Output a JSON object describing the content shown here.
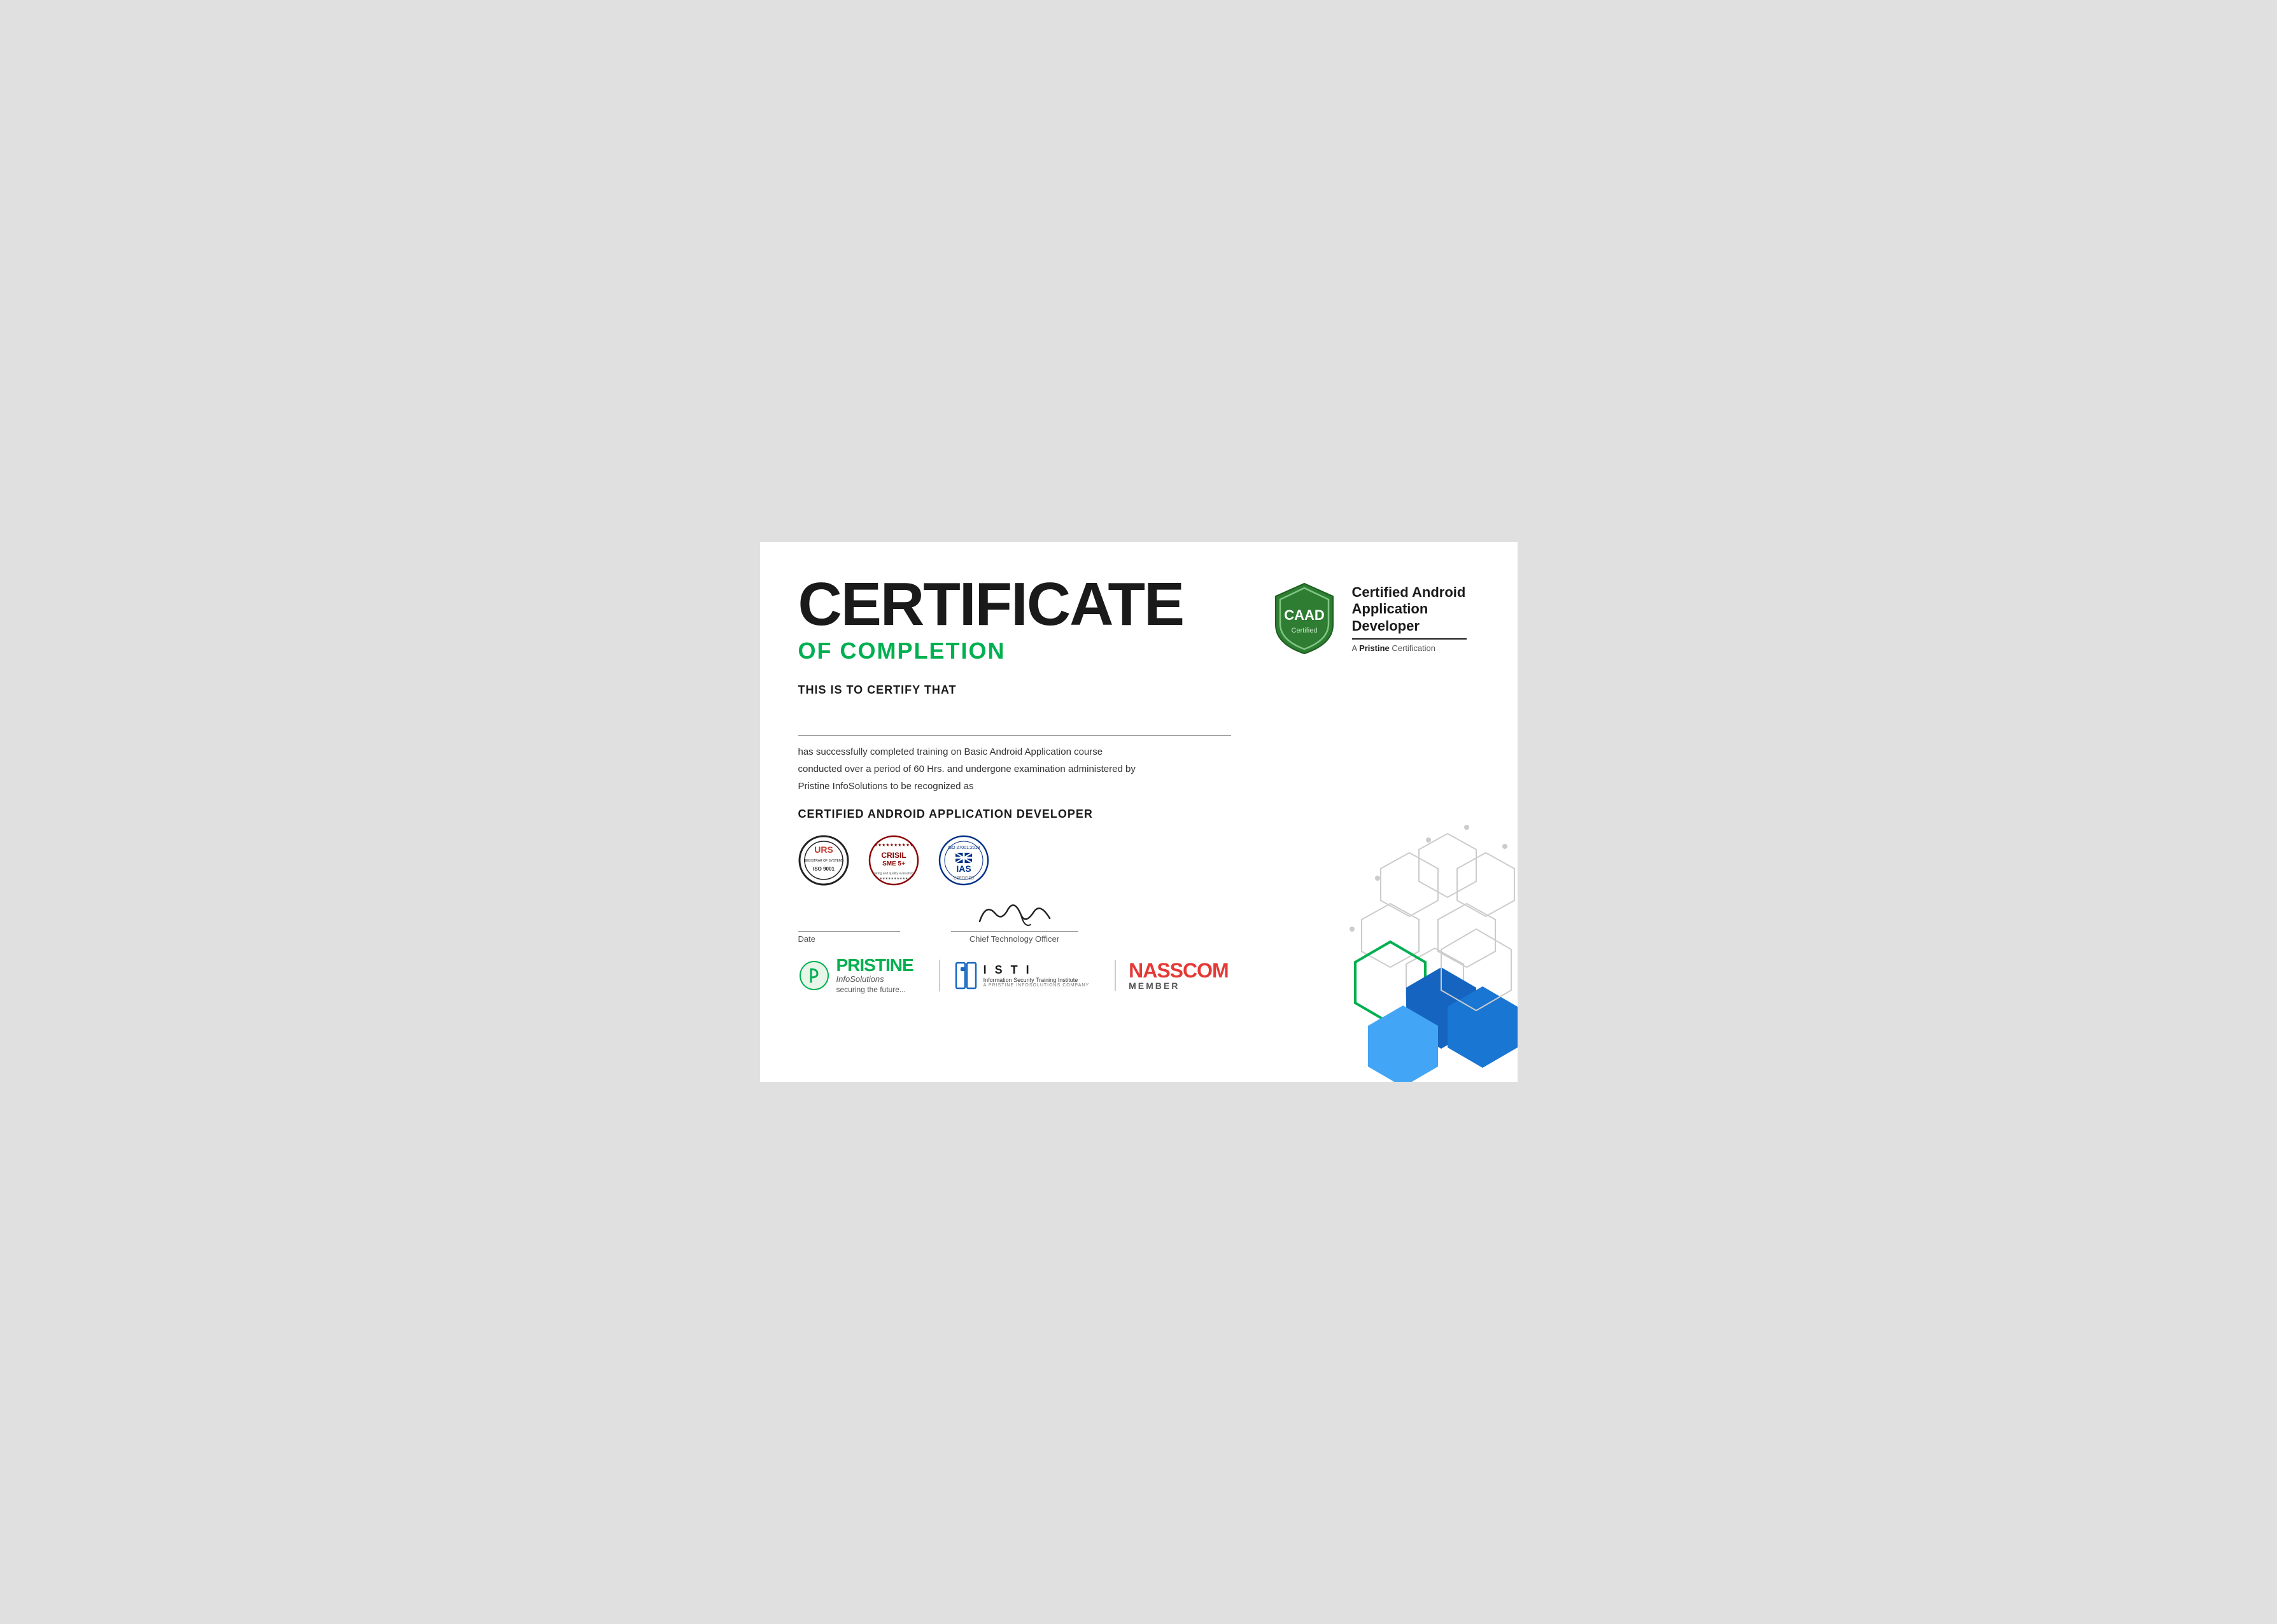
{
  "certificate": {
    "title_main": "CERTIFICATE",
    "title_sub": "OF COMPLETION",
    "certify_label": "THIS IS TO CERTIFY THAT",
    "body_text_1": "has successfully completed training on Basic Android Application course",
    "body_text_2": "conducted over a period of 60 Hrs. and undergone examination administered by",
    "body_text_3": "Pristine InfoSolutions to be recognized as",
    "cert_designation": "CERTIFIED ANDROID APPLICATION DEVELOPER",
    "badge": {
      "title": "Certified Android Application Developer",
      "sub_prefix": "A ",
      "sub_brand": "Pristine",
      "sub_suffix": " Certification",
      "top_text": "CAAD",
      "bottom_text": "Certified"
    },
    "date_label": "Date",
    "cto_label": "Chief Technology Officer",
    "pristine": {
      "name": "PRISTINE",
      "tagline": "InfoSolutions",
      "sub": "securing the future..."
    },
    "isti": {
      "letters": "I S T I",
      "name": "Information Security Training Institute",
      "sub": "A PRISTINE INFOSOLUTIONS COMPANY"
    },
    "nasscom": {
      "name": "NASSCOM",
      "sub": "MEMBER"
    }
  }
}
